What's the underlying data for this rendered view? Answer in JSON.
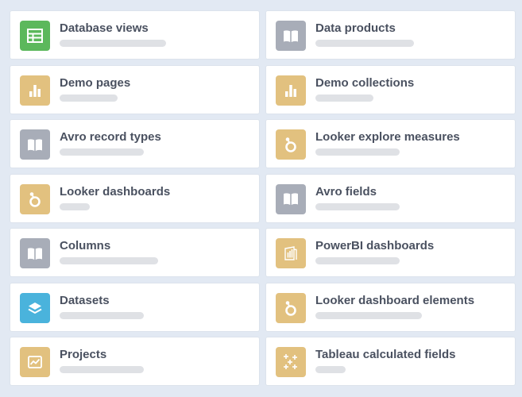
{
  "colors": {
    "background": "#e2e9f3",
    "card": "#ffffff",
    "label": "#4a5160",
    "placeholder_bar": "#dfe1e5",
    "icon_green": "#5cb85c",
    "icon_gray": "#a8adb8",
    "icon_gold": "#e2c17f",
    "icon_blue": "#4ab3dc"
  },
  "cards": [
    {
      "label": "Database views",
      "icon": "table-icon",
      "icon_color": "#5cb85c",
      "bar_fill": 0.53
    },
    {
      "label": "Data products",
      "icon": "book-icon",
      "icon_color": "#a8adb8",
      "bar_fill": 0.49
    },
    {
      "label": "Demo pages",
      "icon": "bar-chart-icon",
      "icon_color": "#e2c17f",
      "bar_fill": 0.29
    },
    {
      "label": "Demo collections",
      "icon": "bar-chart-icon",
      "icon_color": "#e2c17f",
      "bar_fill": 0.29
    },
    {
      "label": "Avro record types",
      "icon": "book-icon",
      "icon_color": "#a8adb8",
      "bar_fill": 0.42
    },
    {
      "label": "Looker explore measures",
      "icon": "looker-icon",
      "icon_color": "#e2c17f",
      "bar_fill": 0.42
    },
    {
      "label": "Looker dashboards",
      "icon": "looker-icon",
      "icon_color": "#e2c17f",
      "bar_fill": 0.15
    },
    {
      "label": "Avro fields",
      "icon": "book-icon",
      "icon_color": "#a8adb8",
      "bar_fill": 0.42
    },
    {
      "label": "Columns",
      "icon": "book-icon",
      "icon_color": "#a8adb8",
      "bar_fill": 0.49
    },
    {
      "label": "PowerBI dashboards",
      "icon": "powerbi-icon",
      "icon_color": "#e2c17f",
      "bar_fill": 0.42
    },
    {
      "label": "Datasets",
      "icon": "layers-icon",
      "icon_color": "#4ab3dc",
      "bar_fill": 0.42
    },
    {
      "label": "Looker dashboard elements",
      "icon": "looker-icon",
      "icon_color": "#e2c17f",
      "bar_fill": 0.53
    },
    {
      "label": "Projects",
      "icon": "line-chart-icon",
      "icon_color": "#e2c17f",
      "bar_fill": 0.42
    },
    {
      "label": "Tableau calculated fields",
      "icon": "sparkles-icon",
      "icon_color": "#e2c17f",
      "bar_fill": 0.15
    }
  ]
}
